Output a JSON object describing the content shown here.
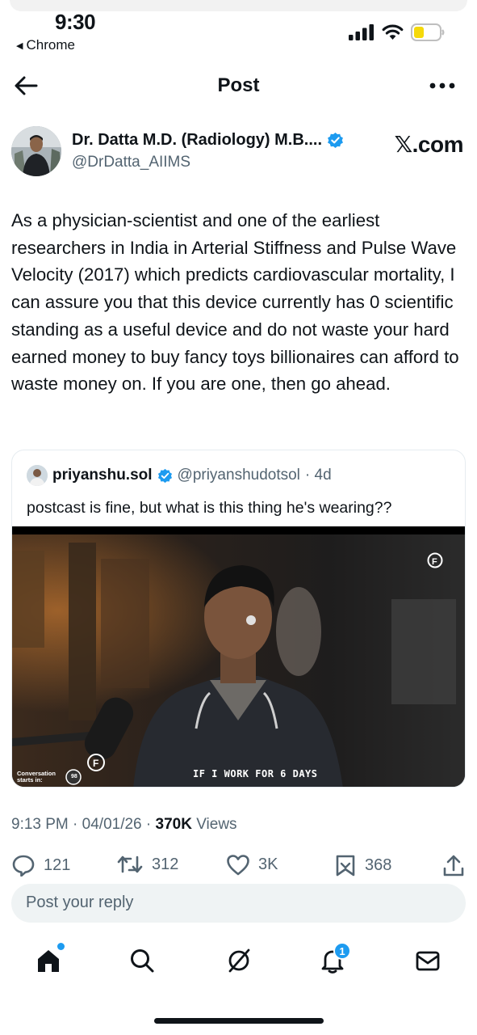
{
  "status_bar": {
    "time": "9:30",
    "back_app": "Chrome"
  },
  "header": {
    "title": "Post"
  },
  "author": {
    "name": "Dr. Datta M.D. (Radiology) M.B....",
    "handle": "@DrDatta_AIIMS",
    "verified": true,
    "watermark": "𝕏.com"
  },
  "tweet": {
    "text": "As a physician-scientist and one of the earliest researchers in India in Arterial Stiffness and Pulse Wave Velocity (2017) which predicts cardiovascular mortality, I can assure you that this device currently has 0 scientific standing as a useful device and do not waste your hard earned money to buy fancy toys billionaires can afford to waste money on. If you are one, then go ahead."
  },
  "quote": {
    "name": "priyanshu.sol",
    "handle": "@priyanshudotsol",
    "age": "· 4d",
    "text": "postcast is fine, but what is this thing he's wearing??",
    "caption": "IF I WORK FOR 6 DAYS",
    "overlay_text": "Conversation starts in:",
    "overlay_count": "98"
  },
  "meta": {
    "time": "9:13 PM",
    "date": "· 04/01/26 ·",
    "views_count": "370K",
    "views_label": "Views"
  },
  "actions": {
    "replies": "121",
    "reposts": "312",
    "likes": "3K",
    "bookmarks": "368"
  },
  "reply_box": {
    "placeholder": "Post your reply"
  },
  "tabbar": {
    "notification_count": "1"
  },
  "colors": {
    "accent": "#1d9bf0",
    "text": "#0f1419",
    "muted": "#536471",
    "battery": "#f5d90a"
  }
}
